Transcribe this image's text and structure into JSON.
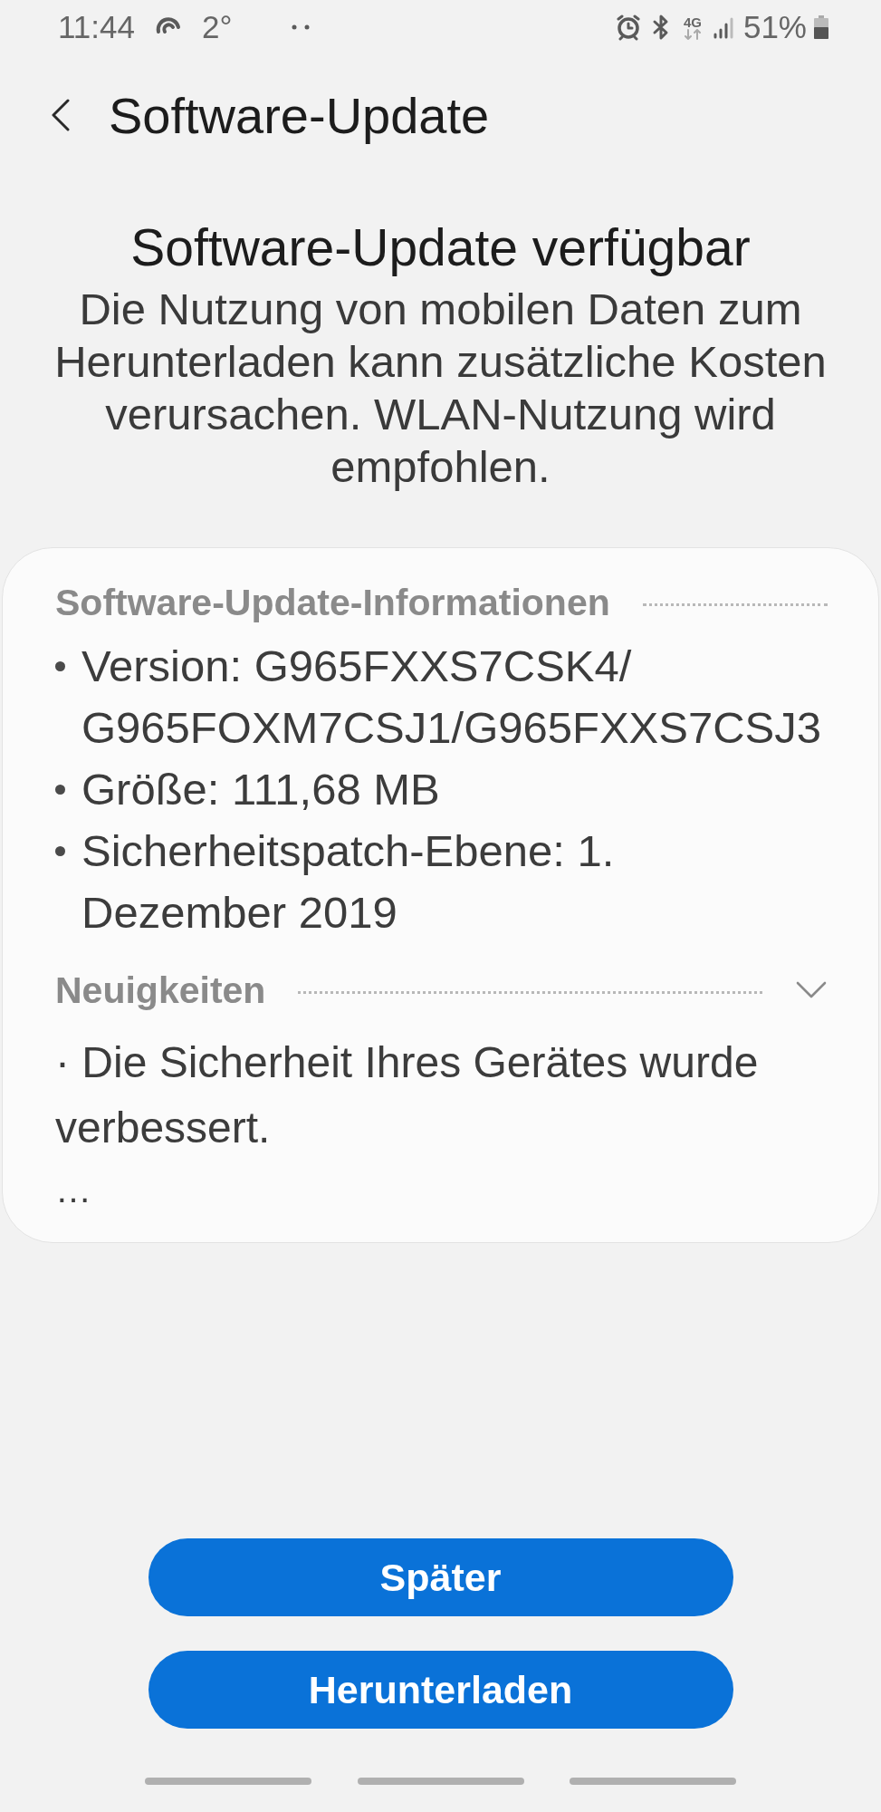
{
  "status_bar": {
    "time": "11:44",
    "temperature": "2°",
    "network": "4G",
    "battery": "51%"
  },
  "header": {
    "title": "Software-Update"
  },
  "heading": "Software-Update verfügbar",
  "message": "Die Nutzung von mobilen Daten zum Herunterladen kann zusätzliche Kosten verursachen. WLAN-Nutzung wird empfohlen.",
  "card": {
    "sections": [
      {
        "kind": "list",
        "title": "Software-Update-Informationen",
        "items": [
          "Version: G965FXXS7CSK4/G965FOXM7CSJ1/G965FXXS7CSJ3",
          "Größe: 111,68 MB",
          "Sicherheitspatch-Ebene: 1. Dezember 2019"
        ]
      },
      {
        "kind": "notes",
        "title": "Neuigkeiten",
        "expanded": false,
        "body": "· Die Sicherheit Ihres Gerätes wurde verbessert.",
        "more": "…"
      }
    ]
  },
  "buttons": [
    "Später",
    "Herunterladen"
  ]
}
